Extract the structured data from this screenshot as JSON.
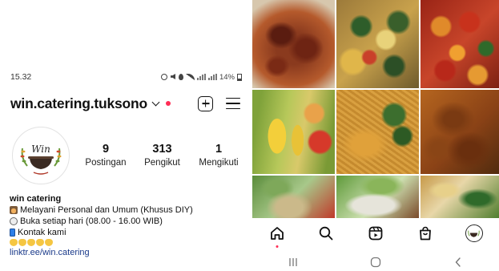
{
  "status_bar": {
    "time": "15.32",
    "battery": "14%"
  },
  "profile": {
    "username": "win.catering.tuksono",
    "stats": [
      {
        "value": "9",
        "label": "Postingan"
      },
      {
        "value": "313",
        "label": "Pengikut"
      },
      {
        "value": "1",
        "label": "Mengikuti"
      }
    ],
    "avatar_logo_text": "Win",
    "bio": {
      "name": "win catering",
      "lines": [
        {
          "icon": "cooking-pot-icon",
          "text": "Melayani Personal dan Umum (Khusus DIY)"
        },
        {
          "icon": "clock-icon",
          "text": "Buka setiap hari (08.00 - 16.00 WIB)"
        },
        {
          "icon": "phone-icon",
          "text": "Kontak kami"
        }
      ],
      "link": "linktr.ee/win.catering"
    }
  },
  "grid": {
    "items": [
      {
        "name": "post-rendang"
      },
      {
        "name": "post-vegetable-stir-fry"
      },
      {
        "name": "post-red-sambal-potato"
      },
      {
        "name": "post-vegetable-soup"
      },
      {
        "name": "post-noodle-dish"
      },
      {
        "name": "post-grilled-chicken"
      },
      {
        "name": "post-steamed-dish"
      },
      {
        "name": "post-leaf-wrapped-dish"
      },
      {
        "name": "post-salad-dish"
      }
    ]
  },
  "bottom_nav": [
    "home-icon",
    "search-icon",
    "reels-icon",
    "shop-icon",
    "profile-avatar"
  ],
  "system_nav": [
    "recent-apps-icon",
    "home-circle-icon",
    "back-chevron-icon"
  ],
  "colors": {
    "notification_dot": "#ff2d55",
    "link": "#1a3a8a"
  }
}
